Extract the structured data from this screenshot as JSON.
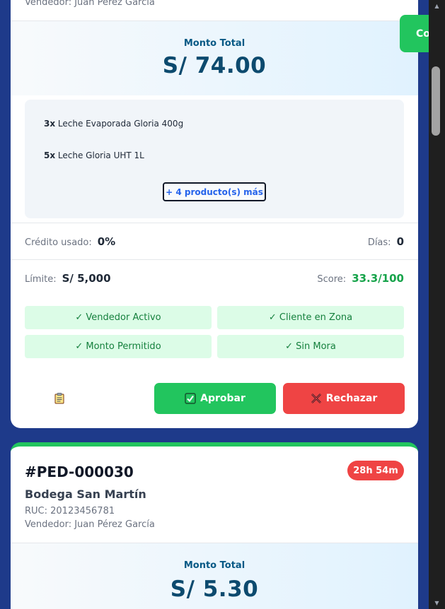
{
  "card1": {
    "vendor": "Vendedor: Juan Pérez García",
    "monto_label": "Monto Total",
    "monto_value": "S/ 74.00",
    "products": [
      {
        "qty": "3x",
        "name": "Leche Evaporada Gloria 400g"
      },
      {
        "qty": "5x",
        "name": "Leche Gloria UHT 1L"
      }
    ],
    "more_label": "+ 4 producto(s) más",
    "credito_label": "Crédito usado:",
    "credito_value": "0%",
    "dias_label": "Días:",
    "dias_value": "0",
    "limite_label": "Límite:",
    "limite_value": "S/ 5,000",
    "score_label": "Score:",
    "score_value": "33.3/100",
    "checks": [
      "✓ Vendedor Activo",
      "✓ Cliente en Zona",
      "✓ Monto Permitido",
      "✓ Sin Mora"
    ],
    "approve_label": "Aprobar",
    "reject_label": "Rechazar"
  },
  "card2": {
    "order_id": "#PED-000030",
    "timer": "28h 54m",
    "store": "Bodega San Martín",
    "ruc": "RUC: 20123456781",
    "vendor": "Vendedor: Juan Pérez García",
    "monto_label": "Monto Total",
    "monto_value": "S/ 5.30"
  },
  "float_button_label": "Co",
  "icons": {
    "clipboard": "clipboard-icon",
    "approve": "check-box-icon",
    "reject": "x-mark-icon"
  },
  "colors": {
    "background": "#1e3a8a",
    "approve": "#22c55e",
    "reject": "#ef4444",
    "accent": "#2563eb"
  }
}
